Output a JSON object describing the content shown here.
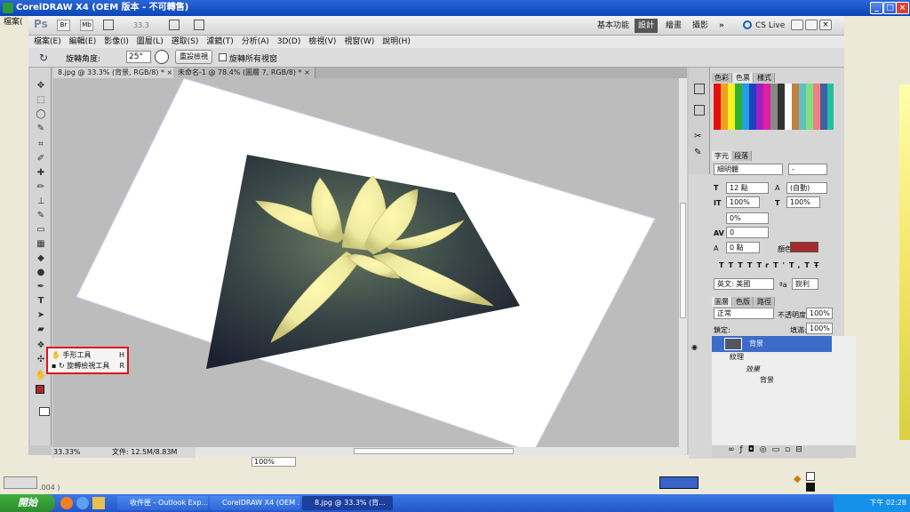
{
  "outer_window": {
    "title": "CorelDRAW X4 (OEM 版本 - 不可轉售)",
    "menu_first": "檔案(",
    "bottom_zoom": "100%",
    "bottom_counter": ".004 )"
  },
  "app_bar": {
    "logo": "Ps",
    "br_label": "Br",
    "mb_label": "Mb",
    "zoom": "33.3",
    "workspaces": [
      "基本功能",
      "設計",
      "繪畫",
      "攝影"
    ],
    "active_workspace": "設計",
    "more": "»",
    "cs_live": "CS Live"
  },
  "menu": [
    "檔案(E)",
    "編輯(E)",
    "影像(I)",
    "圖層(L)",
    "選取(S)",
    "濾鏡(T)",
    "分析(A)",
    "3D(D)",
    "檢視(V)",
    "視窗(W)",
    "說明(H)"
  ],
  "options_bar": {
    "angle_label": "旋轉角度:",
    "angle_value": "25°",
    "reset_button": "重設檢視",
    "rotate_all_label": "旋轉所有視窗"
  },
  "tabs": [
    {
      "label": "8.jpg @ 33.3% (背景, RGB/8) *",
      "close": "×"
    },
    {
      "label": "未命名-1 @ 78.4% (圖層 7, RGB/8) *",
      "close": "×"
    }
  ],
  "status_bar": {
    "zoom": "33.33%",
    "doc_info": "文件: 12.5M/8.83M"
  },
  "flyout": [
    {
      "label": "手形工具",
      "key": "H",
      "icon": "hand-icon"
    },
    {
      "label": "旋轉檢視工具",
      "key": "R",
      "icon": "rotate-view-icon"
    }
  ],
  "panels": {
    "swatch_tabs": [
      "色彩",
      "色票",
      "樣式"
    ],
    "char_tabs": [
      "字元",
      "段落"
    ],
    "font_family": "細明體",
    "font_style": "-",
    "font_size": "12 點",
    "leading": "(自動)",
    "vscale": "100%",
    "hscale": "100%",
    "tracking_pct": "0%",
    "kerning": "0",
    "baseline": "0 點",
    "color_label": "顏色:",
    "text_color": "#a52a2a",
    "typo_buttons": [
      "T",
      "T",
      "TT",
      "Tr",
      "T'",
      "T,",
      "T",
      "Ŧ"
    ],
    "language": "英文: 美國",
    "antialias_label": "ªa",
    "antialias": "銳利",
    "layer_tabs": [
      "圖層",
      "色版",
      "路徑"
    ],
    "blend_mode": "正常",
    "opacity_label": "不透明度:",
    "opacity": "100%",
    "lock_label": "鎖定:",
    "fill_label": "填滿:",
    "fill": "100%",
    "layers": [
      {
        "name": "背景",
        "selected": true
      },
      {
        "name": "紋理",
        "selected": false
      },
      {
        "name": "效果",
        "selected": false
      },
      {
        "name": "背景",
        "selected": false
      }
    ]
  },
  "taskbar": {
    "start": "開始",
    "tasks": [
      {
        "label": "收件匣 - Outlook Exp...",
        "active": false
      },
      {
        "label": "CorelDRAW X4 (OEM ...",
        "active": false
      },
      {
        "label": "8.jpg @ 33.3% (背...",
        "active": true
      }
    ],
    "clock": "下午 02:28"
  },
  "colors": {
    "highlight_red": "#e0141a",
    "foreground": "#a52a2a",
    "selection_blue": "#3c6cc8"
  }
}
